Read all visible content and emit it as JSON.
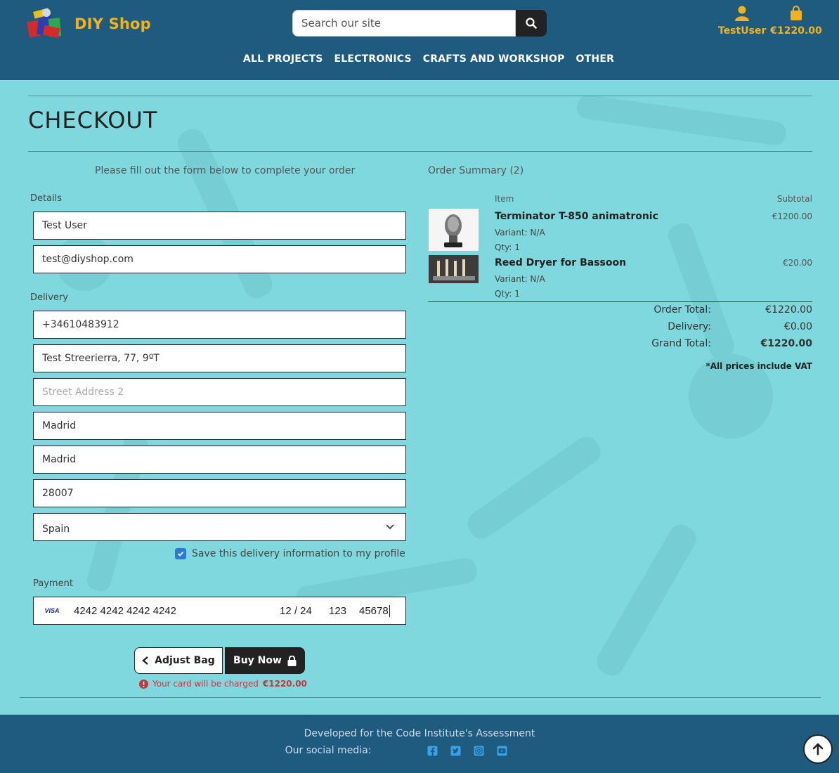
{
  "header": {
    "brand": "DIY Shop",
    "search_placeholder": "Search our site",
    "account_label": "TestUser",
    "bag_total": "€1220.00"
  },
  "nav": {
    "items": [
      "ALL PROJECTS",
      "ELECTRONICS",
      "CRAFTS AND WORKSHOP",
      "OTHER"
    ]
  },
  "page": {
    "title": "CHECKOUT",
    "form_lead": "Please fill out the form below to complete your order",
    "summary_title": "Order Summary (2)"
  },
  "form": {
    "details_label": "Details",
    "full_name": "Test User",
    "email": "test@diyshop.com",
    "delivery_label": "Delivery",
    "phone": "+34610483912",
    "street1": "Test Streerierra, 77, 9ºT",
    "street2_placeholder": "Street Address 2",
    "town": "Madrid",
    "county": "Madrid",
    "postcode": "28007",
    "country": "Spain",
    "save_info_label": "Save this delivery information to my profile",
    "save_info_checked": true,
    "payment_label": "Payment",
    "card": {
      "brand": "VISA",
      "number": "4242 4242 4242 4242",
      "expiry": "12 / 24",
      "cvc": "123",
      "zip": "45678"
    },
    "adjust_label": "Adjust Bag",
    "buy_label": "Buy Now",
    "charge_note": "Your card will be charged",
    "charge_amount": "€1220.00"
  },
  "summary": {
    "col_item": "Item",
    "col_subtotal": "Subtotal",
    "items": [
      {
        "name": "Terminator T-850 animatronic",
        "variant": "Variant: N/A",
        "qty": "Qty: 1",
        "subtotal": "€1200.00"
      },
      {
        "name": "Reed Dryer for Bassoon",
        "variant": "Variant: N/A",
        "qty": "Qty: 1",
        "subtotal": "€20.00"
      }
    ],
    "order_total_label": "Order Total:",
    "order_total": "€1220.00",
    "delivery_label": "Delivery:",
    "delivery": "€0.00",
    "grand_total_label": "Grand Total:",
    "grand_total": "€1220.00",
    "vat_note": "*All prices include VAT"
  },
  "footer": {
    "credit": "Developed for the Code Institute's Assessment",
    "social_label": "Our social media:",
    "social_icons": [
      "facebook-icon",
      "twitter-icon",
      "instagram-icon",
      "youtube-icon"
    ]
  },
  "colors": {
    "header_bg": "#1f5b7f",
    "accent": "#f3b21b",
    "page_bg": "#7fd8dd",
    "error": "#c8363d",
    "checkbox": "#2d7bd0"
  }
}
